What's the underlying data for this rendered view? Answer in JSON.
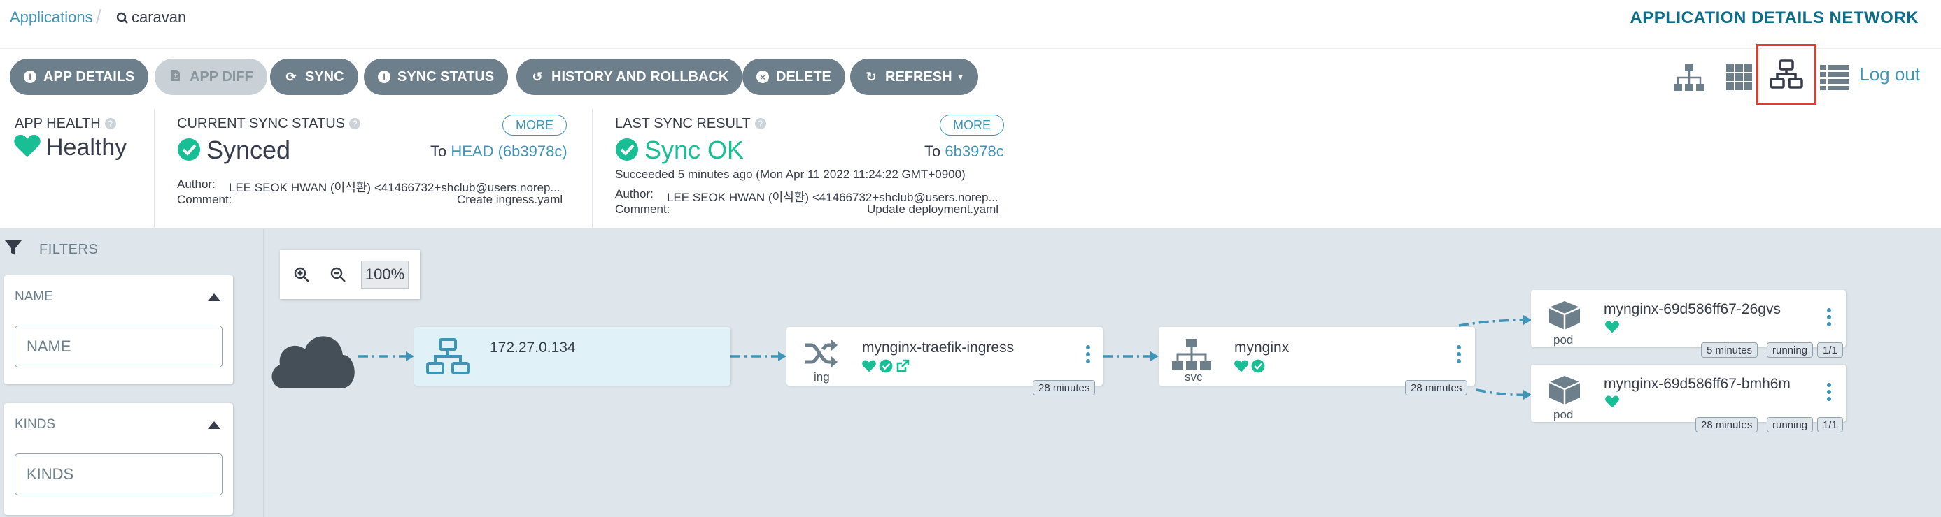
{
  "breadcrumb": {
    "app_link": "Applications",
    "current": "caravan"
  },
  "page_type": "APPLICATION DETAILS NETWORK",
  "toolbar": {
    "app_details": "APP DETAILS",
    "app_diff": "APP DIFF",
    "sync": "SYNC",
    "sync_status": "SYNC STATUS",
    "history": "HISTORY AND ROLLBACK",
    "delete": "DELETE",
    "refresh": "REFRESH"
  },
  "view_icons": [
    "tree-view-icon",
    "pods-view-icon",
    "network-view-icon",
    "list-view-icon"
  ],
  "active_view": "network-view-icon",
  "logout": "Log out",
  "app_health": {
    "label": "APP HEALTH",
    "value": "Healthy",
    "color": "#18be94"
  },
  "current_sync": {
    "label": "CURRENT SYNC STATUS",
    "value": "Synced",
    "more": "MORE",
    "to_prefix": "To",
    "to_rev": "HEAD (6b3978c)",
    "author_label": "Author:",
    "author": "LEE SEOK HWAN (이석환) <41466732+shclub@users.norep...",
    "comment_label": "Comment:",
    "comment": "Create ingress.yaml"
  },
  "last_sync": {
    "label": "LAST SYNC RESULT",
    "value": "Sync OK",
    "more": "MORE",
    "to_prefix": "To",
    "to_rev": "6b3978c",
    "succeeded": "Succeeded 5 minutes ago (Mon Apr 11 2022 11:24:22 GMT+0900)",
    "author_label": "Author:",
    "author": "LEE SEOK HWAN (이석환) <41466732+shclub@users.norep...",
    "comment_label": "Comment:",
    "comment": "Update deployment.yaml"
  },
  "filters": {
    "title": "FILTERS",
    "name": {
      "title": "NAME",
      "placeholder": "NAME"
    },
    "kinds": {
      "title": "KINDS",
      "placeholder": "KINDS"
    }
  },
  "zoom": {
    "level": "100%"
  },
  "graph": {
    "load_balancer": {
      "name": "172.27.0.134"
    },
    "ingress": {
      "name": "mynginx-traefik-ingress",
      "kind": "ing",
      "age": "28 minutes"
    },
    "service": {
      "name": "mynginx",
      "kind": "svc",
      "age": "28 minutes"
    },
    "pods": [
      {
        "name": "mynginx-69d586ff67-26gvs",
        "kind": "pod",
        "age": "5 minutes",
        "status": "running",
        "ready": "1/1"
      },
      {
        "name": "mynginx-69d586ff67-bmh6m",
        "kind": "pod",
        "age": "28 minutes",
        "status": "running",
        "ready": "1/1"
      }
    ]
  },
  "colors": {
    "accent": "#3f95b8",
    "healthy": "#18be94",
    "button": "#6d7f8b",
    "highlight": "#e53b2c",
    "edge": "#3f95b8"
  }
}
